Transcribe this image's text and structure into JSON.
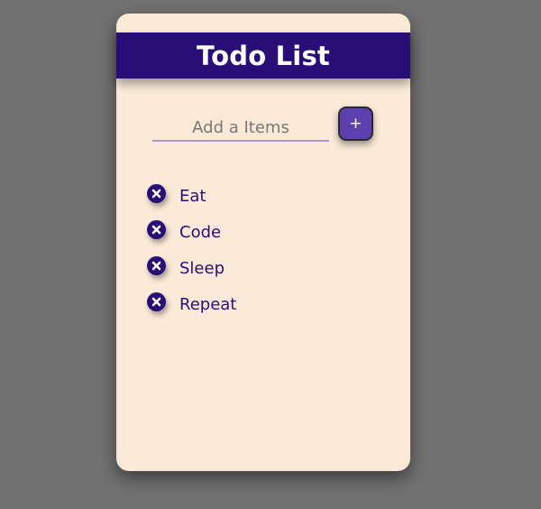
{
  "header": {
    "title": "Todo List"
  },
  "input": {
    "placeholder": "Add a Items",
    "value": ""
  },
  "add_button": {
    "label": "+"
  },
  "items": [
    {
      "label": "Eat",
      "icon": "close-circle-icon"
    },
    {
      "label": "Code",
      "icon": "close-circle-icon"
    },
    {
      "label": "Sleep",
      "icon": "close-circle-icon"
    },
    {
      "label": "Repeat",
      "icon": "close-circle-icon"
    }
  ],
  "colors": {
    "background": "#727171",
    "card": "#faead7",
    "accent": "#2a0e77",
    "button": "#5d40ad",
    "underline": "#a995d9"
  }
}
